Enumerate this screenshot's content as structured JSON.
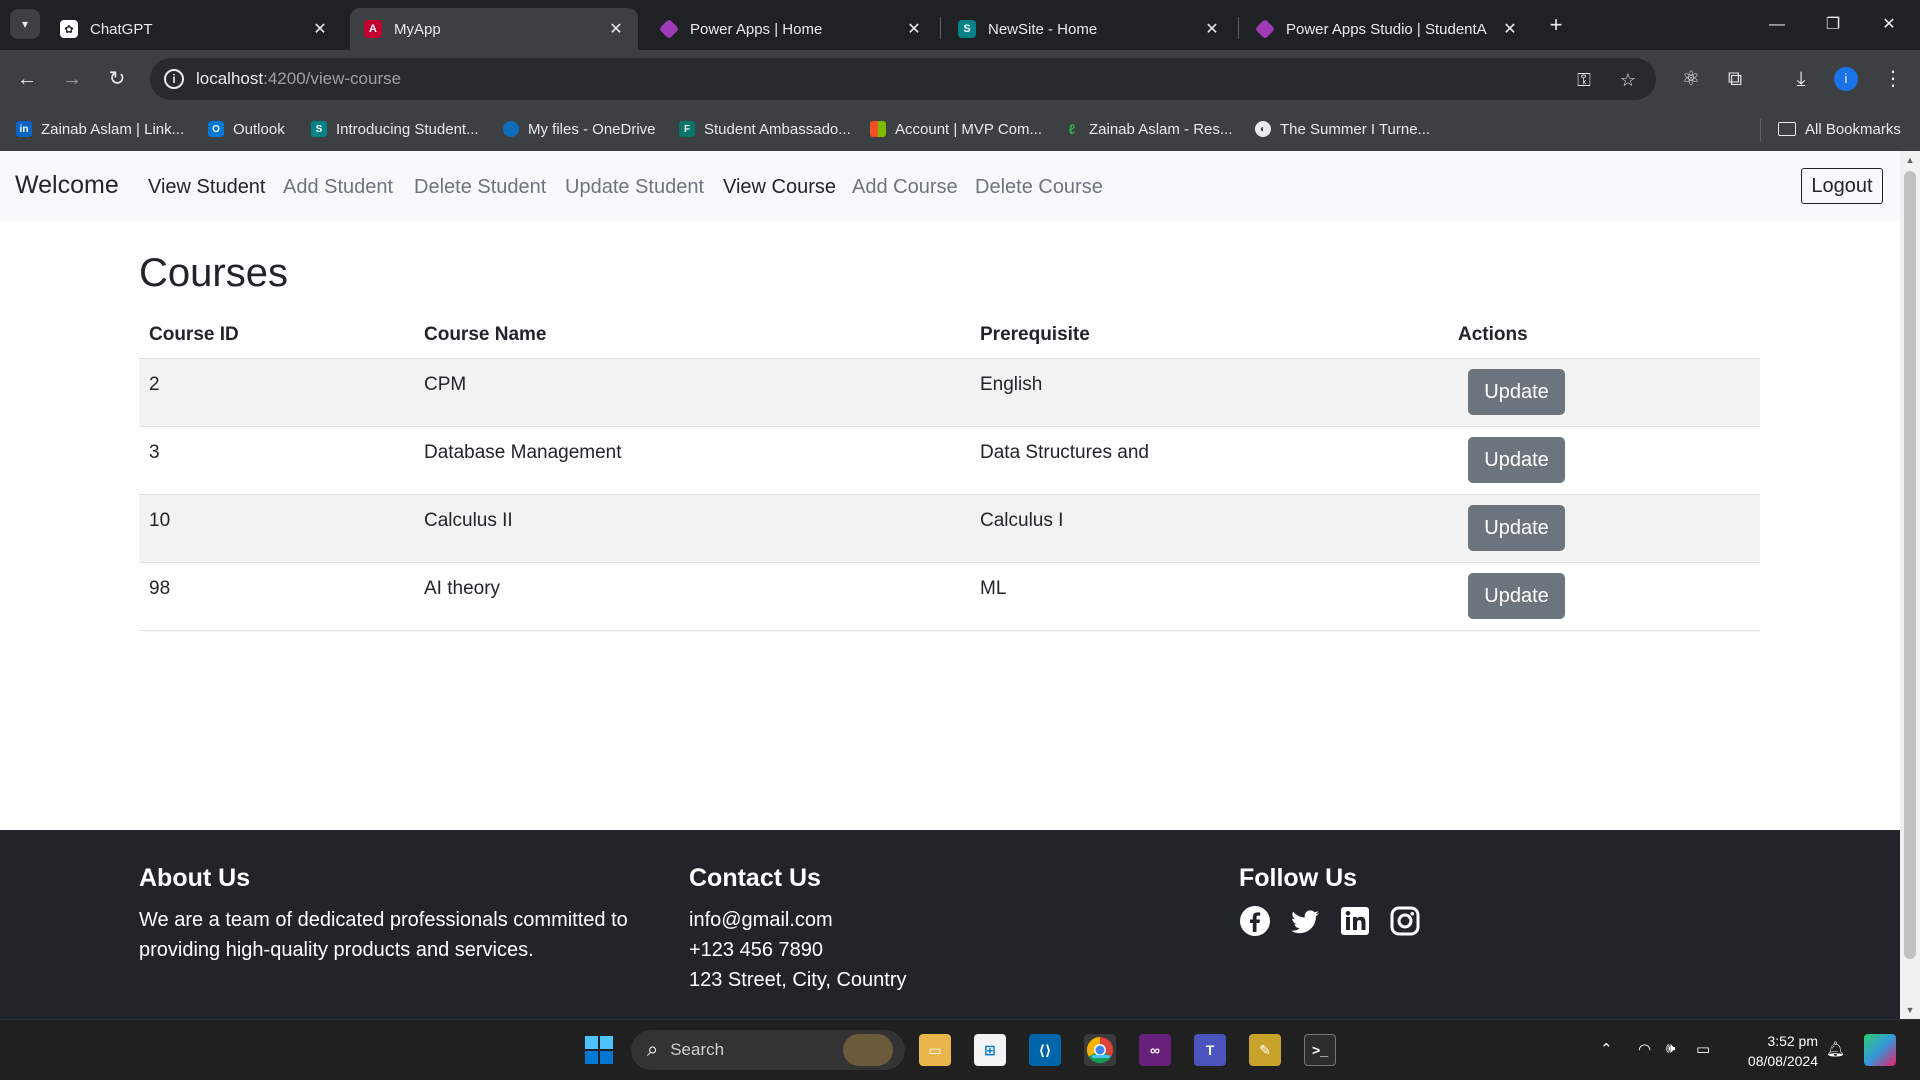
{
  "browser": {
    "tabs": [
      {
        "title": "ChatGPT",
        "icon": "chatgpt-icon",
        "active": false
      },
      {
        "title": "MyApp",
        "icon": "angular-icon",
        "active": true
      },
      {
        "title": "Power Apps | Home",
        "icon": "powerapps-icon",
        "active": false
      },
      {
        "title": "NewSite - Home",
        "icon": "sharepoint-icon",
        "active": false
      },
      {
        "title": "Power Apps Studio  |  StudentA",
        "icon": "powerapps-icon",
        "active": false
      }
    ],
    "url_host": "localhost",
    "url_path": ":4200/view-course",
    "bookmarks": [
      {
        "label": "Zainab Aslam | Link...",
        "icon": "linkedin-icon"
      },
      {
        "label": "Outlook",
        "icon": "outlook-icon"
      },
      {
        "label": "Introducing Student...",
        "icon": "sharepoint-icon"
      },
      {
        "label": "My files - OneDrive",
        "icon": "onedrive-icon"
      },
      {
        "label": "Student Ambassado...",
        "icon": "forms-icon"
      },
      {
        "label": "Account | MVP Com...",
        "icon": "microsoft-icon"
      },
      {
        "label": "Zainab Aslam - Res...",
        "icon": "leaf-icon"
      },
      {
        "label": "The Summer I Turne...",
        "icon": "globe-icon"
      }
    ],
    "all_bookmarks": "All Bookmarks",
    "profile_initial": "i"
  },
  "app": {
    "brand": "Welcome",
    "nav": [
      "View Student",
      "Add Student",
      "Delete Student",
      "Update Student",
      "View Course",
      "Add Course",
      "Delete Course"
    ],
    "logout": "Logout",
    "page_title": "Courses",
    "table": {
      "headers": [
        "Course ID",
        "Course Name",
        "Prerequisite",
        "Actions"
      ],
      "rows": [
        {
          "id": "2",
          "name": "CPM",
          "prereq": "English",
          "action": "Update"
        },
        {
          "id": "3",
          "name": "Database Management",
          "prereq": "Data Structures and",
          "action": "Update"
        },
        {
          "id": "10",
          "name": "Calculus II",
          "prereq": "Calculus I",
          "action": "Update"
        },
        {
          "id": "98",
          "name": "AI theory",
          "prereq": "ML",
          "action": "Update"
        }
      ]
    },
    "footer": {
      "about_title": "About Us",
      "about_text": "We are a team of dedicated professionals committed to providing high-quality products and services.",
      "contact_title": "Contact Us",
      "email": "info@gmail.com",
      "phone": "+123 456 7890",
      "address": "123 Street, City, Country",
      "follow_title": "Follow Us",
      "social": [
        "facebook-icon",
        "twitter-icon",
        "linkedin-icon",
        "instagram-icon"
      ]
    }
  },
  "taskbar": {
    "search_placeholder": "Search",
    "time": "3:52 pm",
    "date": "08/08/2024",
    "apps": [
      "windows-start-icon",
      "file-explorer-icon",
      "microsoft-store-icon",
      "vscode-icon",
      "chrome-icon",
      "visual-studio-icon",
      "teams-icon",
      "paint-icon",
      "terminal-icon"
    ]
  },
  "colors": {
    "nav_bg": "#f8f9fa",
    "footer_bg": "#212529",
    "button_secondary": "#6c757d",
    "table_stripe": "#f2f2f2"
  }
}
